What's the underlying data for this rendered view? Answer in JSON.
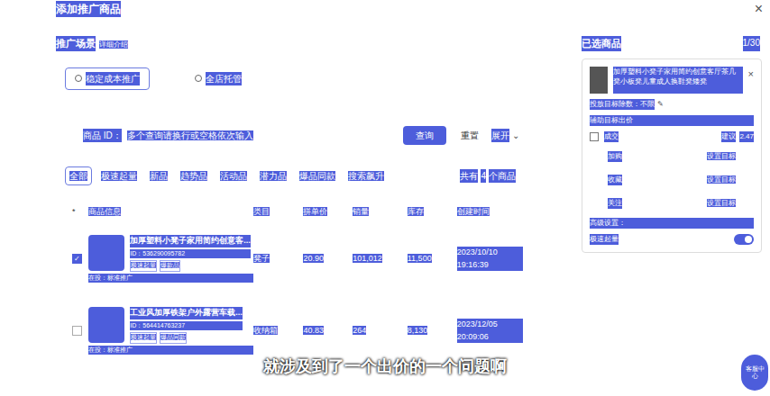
{
  "text_selected": true,
  "dialog": {
    "title": "添加推广商品",
    "close": "×"
  },
  "scene": {
    "label": "推广场景",
    "link": "详细介绍",
    "options": [
      {
        "label": "稳定成本推广",
        "selected": true
      },
      {
        "label": "全店托管",
        "selected": false
      }
    ]
  },
  "search": {
    "label": "商品 ID：",
    "placeholder": "多个查询请换行或空格依次输入",
    "query_button": "查询",
    "reset_button": "重置",
    "expand_button": "展开",
    "expand_icon": "⌄"
  },
  "filters": [
    {
      "label": "全部",
      "selected": true
    },
    {
      "label": "极速起量",
      "selected": false
    },
    {
      "label": "新品",
      "selected": false
    },
    {
      "label": "趋势品",
      "selected": false
    },
    {
      "label": "活动品",
      "selected": false
    },
    {
      "label": "潜力品",
      "selected": false
    },
    {
      "label": "爆品同款",
      "selected": false
    },
    {
      "label": "搜索飙升",
      "selected": false
    }
  ],
  "count": {
    "prefix": "共有",
    "value": "4",
    "suffix": "个商品"
  },
  "table": {
    "columns": [
      "商品信息",
      "类目",
      "拼单价",
      "销量",
      "库存",
      "创建时间"
    ],
    "rows": [
      {
        "checked": true,
        "title": "加厚塑料小凳子家用简约创意客...",
        "id": "ID：536290095782",
        "tags": [
          "极速起量",
          "爆款品"
        ],
        "status": "在投：标准推广",
        "category": "凳子",
        "price": "20.90",
        "sales": "101,012",
        "stock": "11,500",
        "date": "2023/10/10",
        "time": "19:16:39"
      },
      {
        "checked": false,
        "title": "工业风加厚铁架户外露营车载...",
        "id": "ID：564414763237",
        "tags": [
          "极速起量",
          "爆品同款"
        ],
        "status": "在投：标准推广",
        "category": "收纳箱",
        "price": "40.83",
        "sales": "264",
        "stock": "8,130",
        "date": "2023/12/05",
        "time": "20:09:06"
      }
    ]
  },
  "selected_panel": {
    "title": "已选商品",
    "count": "1/30",
    "item_title": "加厚塑料小凳子家用简约创意客厅茶几凳小板凳儿童成人换鞋凳矮凳",
    "item_close": "×",
    "target": "投放目标除数：不限",
    "assist_label": "辅助目标出价",
    "deal_label": "成交",
    "deal_hint": "建议",
    "deal_value": "2.47",
    "goals": [
      {
        "label": "加购",
        "action": "设置目标"
      },
      {
        "label": "收藏",
        "action": "设置目标"
      },
      {
        "label": "关注",
        "action": "设置目标"
      }
    ],
    "advanced_label": "高级设置：",
    "boost_label": "极速起量",
    "boost_on": true
  },
  "subtitle": "就涉及到了一个出价的一个问题啊",
  "help": "客服中心"
}
